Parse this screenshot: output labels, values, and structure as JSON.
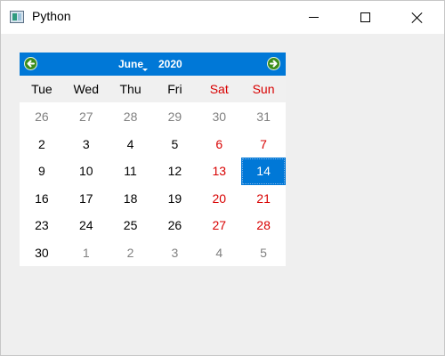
{
  "window": {
    "title": "Python",
    "icon": "python-window-icon"
  },
  "calendar": {
    "month": "June",
    "year": "2020",
    "prev_icon": "arrow-left-icon",
    "next_icon": "arrow-right-icon",
    "header_color": "#0078d7",
    "weekend_color": "#d80000",
    "weekdays": [
      "Tue",
      "Wed",
      "Thu",
      "Fri",
      "Sat",
      "Sun"
    ],
    "weeks": [
      [
        {
          "d": "26",
          "other": true
        },
        {
          "d": "27",
          "other": true
        },
        {
          "d": "28",
          "other": true
        },
        {
          "d": "29",
          "other": true
        },
        {
          "d": "30",
          "other": true
        },
        {
          "d": "31",
          "other": true
        }
      ],
      [
        {
          "d": "2"
        },
        {
          "d": "3"
        },
        {
          "d": "4"
        },
        {
          "d": "5"
        },
        {
          "d": "6"
        },
        {
          "d": "7"
        }
      ],
      [
        {
          "d": "9"
        },
        {
          "d": "10"
        },
        {
          "d": "11"
        },
        {
          "d": "12"
        },
        {
          "d": "13"
        },
        {
          "d": "14",
          "selected": true
        }
      ],
      [
        {
          "d": "16"
        },
        {
          "d": "17"
        },
        {
          "d": "18"
        },
        {
          "d": "19"
        },
        {
          "d": "20"
        },
        {
          "d": "21"
        }
      ],
      [
        {
          "d": "23"
        },
        {
          "d": "24"
        },
        {
          "d": "25"
        },
        {
          "d": "26"
        },
        {
          "d": "27"
        },
        {
          "d": "28"
        }
      ],
      [
        {
          "d": "30"
        },
        {
          "d": "1",
          "other": true
        },
        {
          "d": "2",
          "other": true
        },
        {
          "d": "3",
          "other": true
        },
        {
          "d": "4",
          "other": true
        },
        {
          "d": "5",
          "other": true
        }
      ]
    ]
  }
}
